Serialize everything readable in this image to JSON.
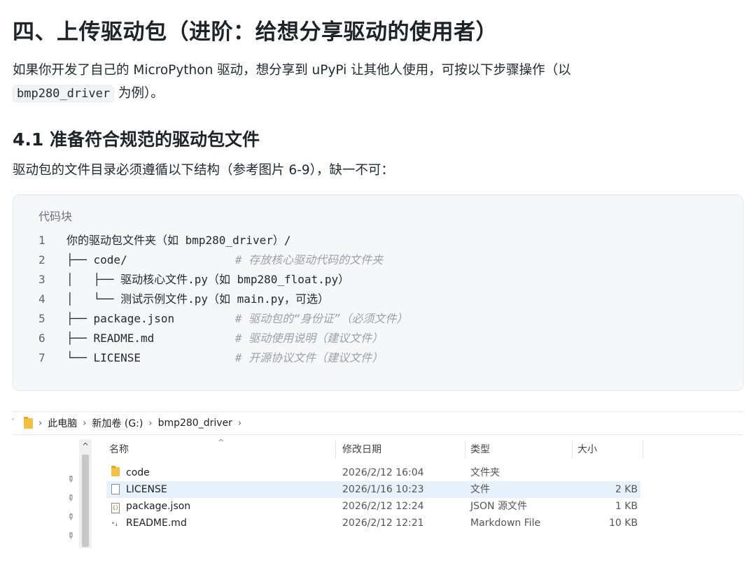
{
  "heading1": "四、上传驱动包（进阶：给想分享驱动的使用者）",
  "intro": {
    "text_before": "如果你开发了自己的 MicroPython 驱动，想分享到 uPyPi 让其他人使用，可按以下步骤操作（以",
    "code": "bmp280_driver",
    "text_after": " 为例）。"
  },
  "heading2": "4.1 准备符合规范的驱动包文件",
  "para2": "驱动包的文件目录必须遵循以下结构（参考图片 6-9），缺一不可：",
  "code_block": {
    "label": "代码块",
    "lines": [
      {
        "n": "1",
        "code": "你的驱动包文件夹（如 bmp280_driver）/",
        "comment": ""
      },
      {
        "n": "2",
        "code": "├── code/                ",
        "comment": "# 存放核心驱动代码的文件夹"
      },
      {
        "n": "3",
        "code": "│   ├── 驱动核心文件.py（如 bmp280_float.py）",
        "comment": ""
      },
      {
        "n": "4",
        "code": "│   └── 测试示例文件.py（如 main.py，可选）",
        "comment": ""
      },
      {
        "n": "5",
        "code": "├── package.json         ",
        "comment": "# 驱动包的“身份证”（必须文件）"
      },
      {
        "n": "6",
        "code": "├── README.md            ",
        "comment": "# 驱动使用说明（建议文件）"
      },
      {
        "n": "7",
        "code": "└── LICENSE              ",
        "comment": "# 开源协议文件（建议文件）"
      }
    ]
  },
  "explorer": {
    "breadcrumb": [
      "此电脑",
      "新加卷 (G:)",
      "bmp280_driver"
    ],
    "columns": {
      "name": "名称",
      "date": "修改日期",
      "type": "类型",
      "size": "大小"
    },
    "rows": [
      {
        "icon": "folder-icon",
        "name": "code",
        "date": "2026/2/12 16:04",
        "type": "文件夹",
        "size": "",
        "selected": false
      },
      {
        "icon": "file-icon",
        "name": "LICENSE",
        "date": "2026/1/16 10:23",
        "type": "文件",
        "size": "2 KB",
        "selected": true
      },
      {
        "icon": "json-file-icon",
        "name": "package.json",
        "date": "2026/2/12 12:24",
        "type": "JSON 源文件",
        "size": "1 KB",
        "selected": false
      },
      {
        "icon": "markdown-file-icon",
        "name": "README.md",
        "date": "2026/2/12 12:21",
        "type": "Markdown File",
        "size": "10 KB",
        "selected": false
      }
    ]
  },
  "colors": {
    "selected_row": "#e6f1fb",
    "code_bg": "#f6f7f9",
    "folder": "#f3c13d"
  }
}
